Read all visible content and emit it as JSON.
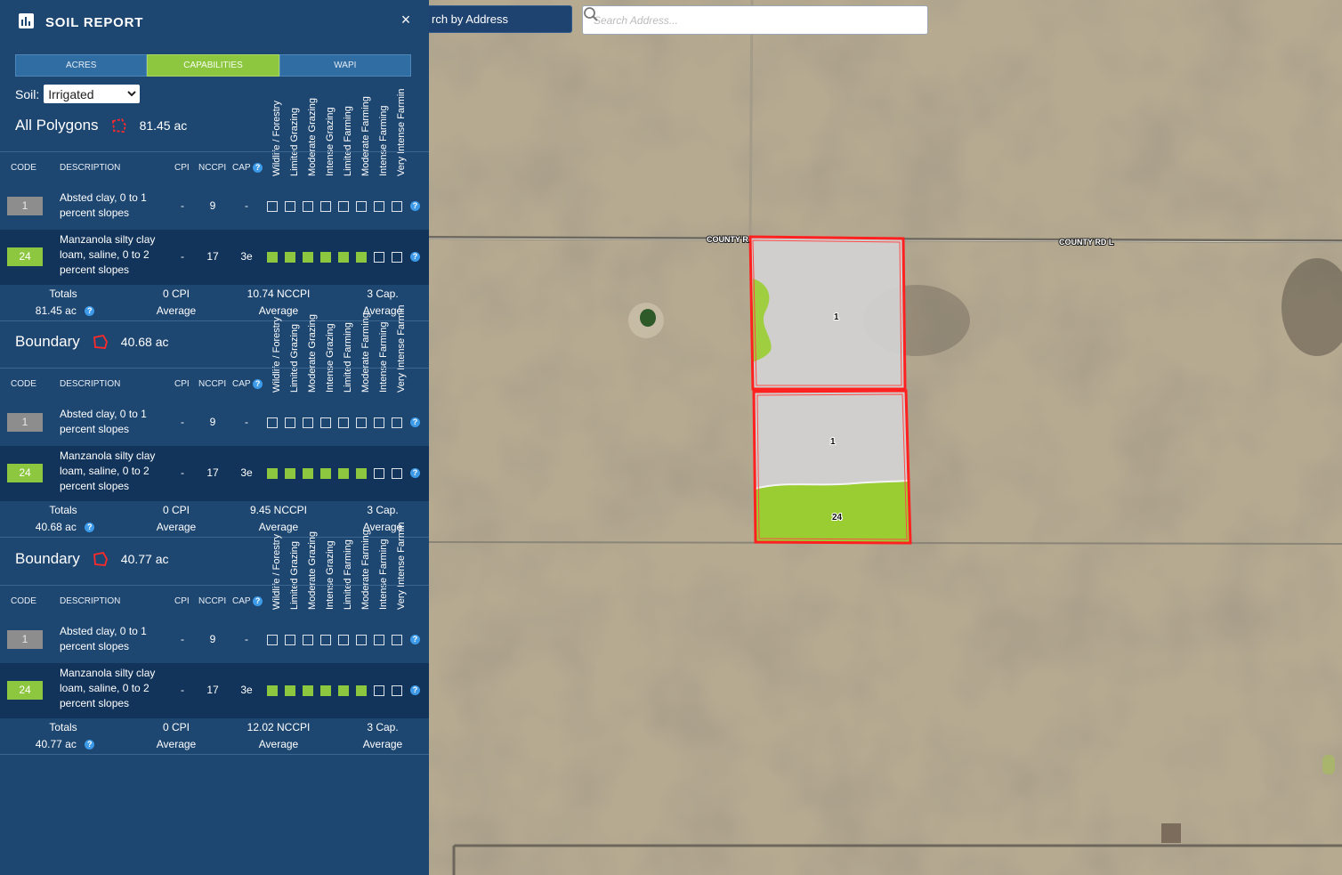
{
  "search": {
    "mode_label": "rch by Address",
    "placeholder": "Search Address..."
  },
  "map": {
    "road_labels": [
      "COUNTY R",
      "COUNTY RD L"
    ],
    "polygon_labels": [
      "1",
      "1",
      "24"
    ],
    "colors": {
      "boundary": "#ff2020",
      "soil_grey": "#cfcfcf",
      "soil_green": "#9acd32"
    }
  },
  "panel": {
    "title": "SOIL REPORT",
    "close_symbol": "×",
    "tabs": [
      {
        "label": "ACRES",
        "active": false
      },
      {
        "label": "CAPABILITIES",
        "active": true
      },
      {
        "label": "WAPI",
        "active": false
      }
    ],
    "soil_label": "Soil:",
    "soil_options": [
      "Irrigated"
    ],
    "soil_selected": "Irrigated",
    "capability_headers": [
      "Wildlife / Forestry",
      "Limited Grazing",
      "Moderate Grazing",
      "Intense Grazing",
      "Limited Farming",
      "Moderate Farming",
      "Intense Farming",
      "Very Intense Farming"
    ],
    "columns": {
      "code": "CODE",
      "description": "DESCRIPTION",
      "cpi": "CPI",
      "nccpi": "NCCPI",
      "cap": "CAP"
    },
    "help_symbol": "?",
    "sections": [
      {
        "title": "All Polygons",
        "acres": "81.45 ac",
        "rows": [
          {
            "code": "1",
            "description": "Absted clay, 0 to 1 percent slopes",
            "cpi": "-",
            "nccpi": "9",
            "cap": "-",
            "filled": 0
          },
          {
            "code": "24",
            "description": "Manzanola silty clay loam, saline, 0 to 2 percent slopes",
            "cpi": "-",
            "nccpi": "17",
            "cap": "3e",
            "filled": 6
          }
        ],
        "totals": {
          "label": "Totals",
          "acres": "81.45 ac",
          "cpi": "0 CPI",
          "cpi_sub": "Average",
          "nccpi": "10.74 NCCPI",
          "nccpi_sub": "Average",
          "cap": "3 Cap.",
          "cap_sub": "Average"
        }
      },
      {
        "title": "Boundary",
        "acres": "40.68 ac",
        "rows": [
          {
            "code": "1",
            "description": "Absted clay, 0 to 1 percent slopes",
            "cpi": "-",
            "nccpi": "9",
            "cap": "-",
            "filled": 0
          },
          {
            "code": "24",
            "description": "Manzanola silty clay loam, saline, 0 to 2 percent slopes",
            "cpi": "-",
            "nccpi": "17",
            "cap": "3e",
            "filled": 6
          }
        ],
        "totals": {
          "label": "Totals",
          "acres": "40.68 ac",
          "cpi": "0 CPI",
          "cpi_sub": "Average",
          "nccpi": "9.45 NCCPI",
          "nccpi_sub": "Average",
          "cap": "3 Cap.",
          "cap_sub": "Average"
        }
      },
      {
        "title": "Boundary",
        "acres": "40.77 ac",
        "rows": [
          {
            "code": "1",
            "description": "Absted clay, 0 to 1 percent slopes",
            "cpi": "-",
            "nccpi": "9",
            "cap": "-",
            "filled": 0
          },
          {
            "code": "24",
            "description": "Manzanola silty clay loam, saline, 0 to 2 percent slopes",
            "cpi": "-",
            "nccpi": "17",
            "cap": "3e",
            "filled": 6
          }
        ],
        "totals": {
          "label": "Totals",
          "acres": "40.77 ac",
          "cpi": "0 CPI",
          "cpi_sub": "Average",
          "nccpi": "12.02 NCCPI",
          "nccpi_sub": "Average",
          "cap": "3 Cap.",
          "cap_sub": "Average"
        }
      }
    ]
  }
}
